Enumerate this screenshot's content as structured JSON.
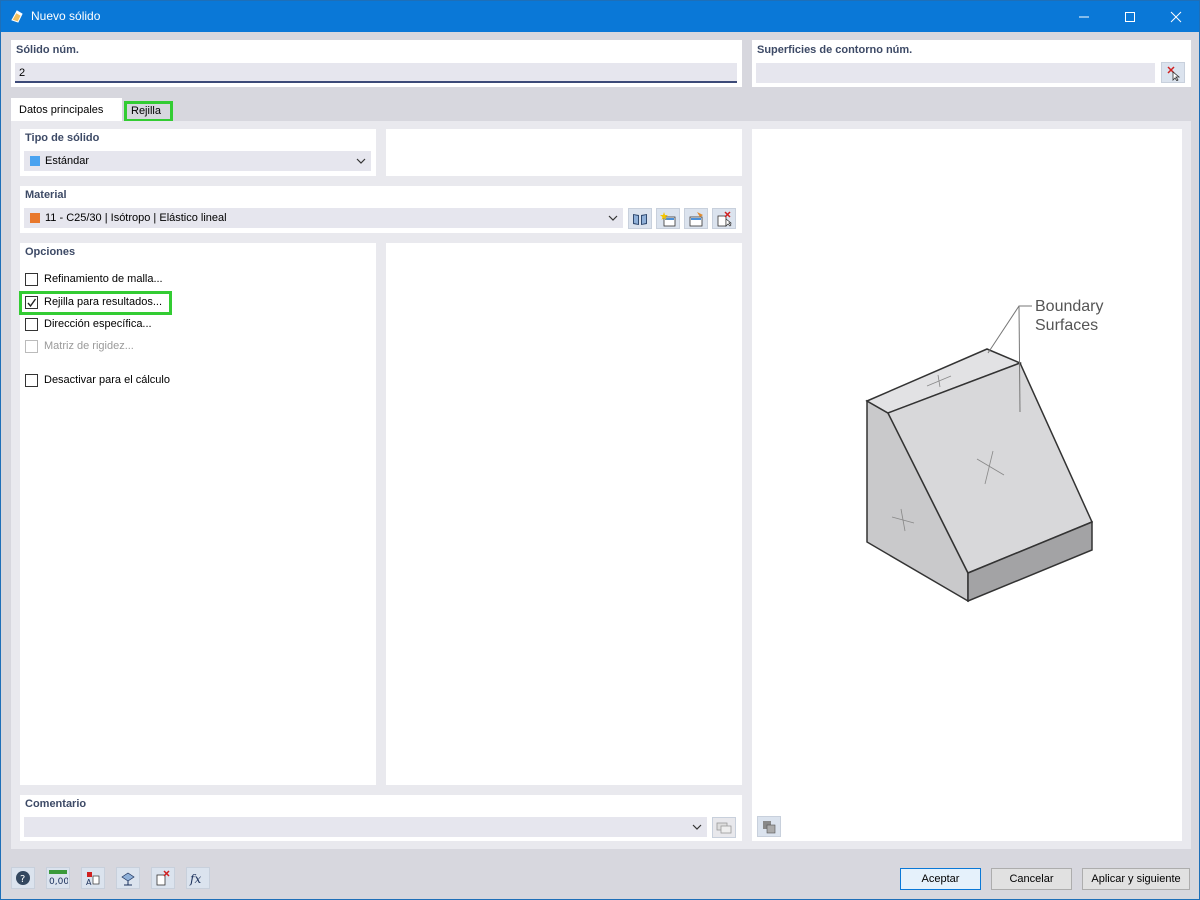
{
  "window": {
    "title": "Nuevo sólido"
  },
  "header": {
    "solid_no_label": "Sólido núm.",
    "solid_no_value": "2",
    "boundary_label": "Superficies de contorno núm.",
    "boundary_value": ""
  },
  "tabs": [
    {
      "label": "Datos principales",
      "active": true
    },
    {
      "label": "Rejilla",
      "active": false,
      "highlighted": true
    }
  ],
  "solid_type": {
    "label": "Tipo de sólido",
    "value": "Estándar",
    "swatch_color": "#4aa3f0"
  },
  "material": {
    "label": "Material",
    "value": "11 - C25/30 | Isótropo | Elástico lineal",
    "swatch_color": "#e8782c",
    "buttons": [
      "library-icon",
      "new-material-icon",
      "edit-material-icon",
      "select-material-icon"
    ]
  },
  "options": {
    "label": "Opciones",
    "items": [
      {
        "label": "Refinamiento de malla...",
        "checked": false,
        "enabled": true
      },
      {
        "label": "Rejilla para resultados...",
        "checked": true,
        "enabled": true,
        "highlighted": true
      },
      {
        "label": "Dirección específica...",
        "checked": false,
        "enabled": true
      },
      {
        "label": "Matriz de rigidez...",
        "checked": false,
        "enabled": false
      },
      {
        "label": "Desactivar para el cálculo",
        "checked": false,
        "enabled": true
      }
    ]
  },
  "comment": {
    "label": "Comentario",
    "value": ""
  },
  "illustration": {
    "caption_line1": "Boundary",
    "caption_line2": "Surfaces"
  },
  "buttons": {
    "ok": "Aceptar",
    "cancel": "Cancelar",
    "apply_next": "Aplicar y siguiente"
  },
  "colors": {
    "titlebar": "#0a78d7",
    "highlight": "#33cc33",
    "label_text": "#3d4a66"
  }
}
